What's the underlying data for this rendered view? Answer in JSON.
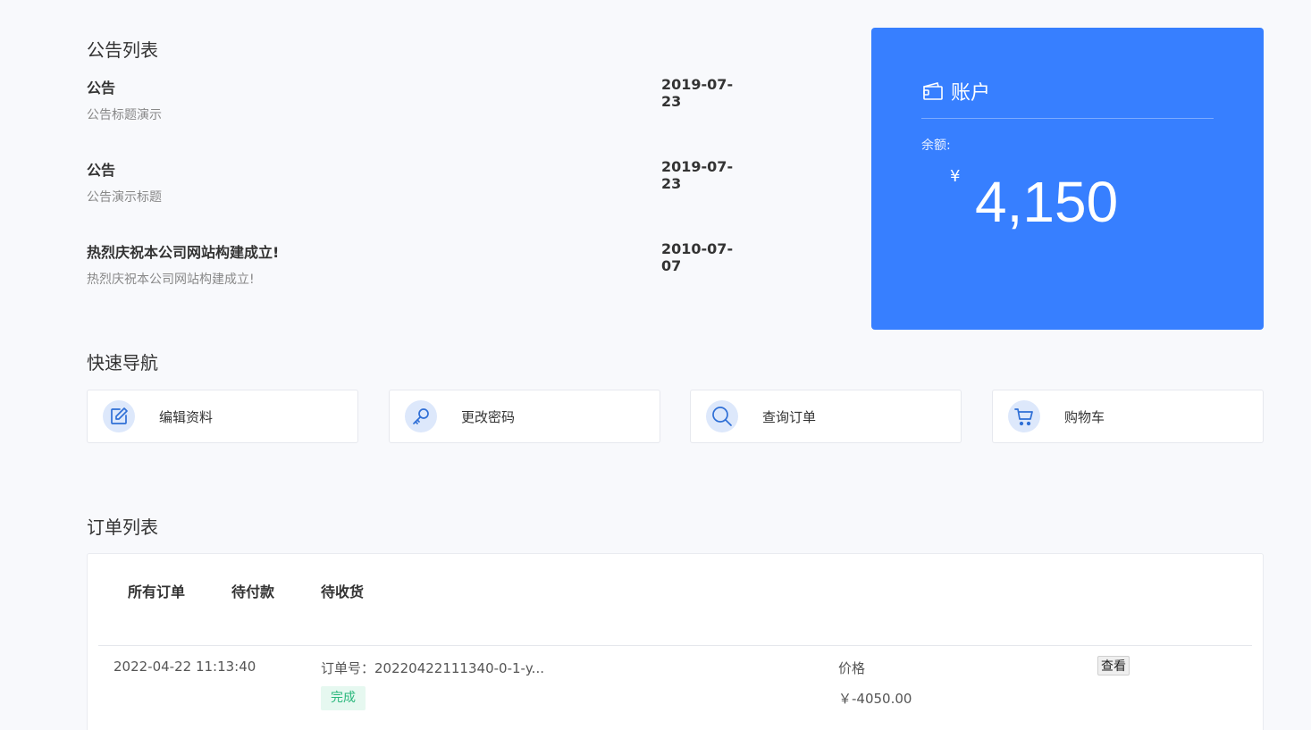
{
  "notices": {
    "section_title": "公告列表",
    "items": [
      {
        "title": "公告",
        "desc": "公告标题演示",
        "date": "2019-07-23"
      },
      {
        "title": "公告",
        "desc": "公告演示标题",
        "date": "2019-07-23"
      },
      {
        "title": "热烈庆祝本公司网站构建成立!",
        "desc": "热烈庆祝本公司网站构建成立!",
        "date": "2010-07-07"
      }
    ]
  },
  "account": {
    "title": "账户",
    "icon": "wallet-icon",
    "balance_label": "余额:",
    "currency": "¥",
    "balance": "4,150",
    "color": "#377fff"
  },
  "quicknav": {
    "title": "快速导航",
    "items": [
      {
        "label": "编辑资料",
        "icon": "edit-icon"
      },
      {
        "label": "更改密码",
        "icon": "key-icon"
      },
      {
        "label": "查询订单",
        "icon": "search-icon"
      },
      {
        "label": "购物车",
        "icon": "cart-icon"
      }
    ]
  },
  "orders": {
    "title": "订单列表",
    "tabs": [
      "所有订单",
      "待付款",
      "待收货"
    ],
    "rows": [
      {
        "time": "2022-04-22 11:13:40",
        "order_no": "订单号：20220422111340-0-1-y...",
        "status": "完成",
        "price_label": "价格",
        "price": "￥-4050.00",
        "action": "查看"
      }
    ]
  }
}
